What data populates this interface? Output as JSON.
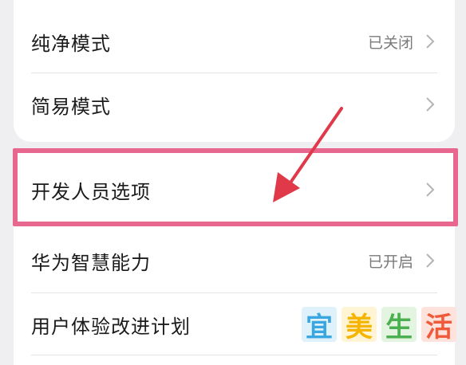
{
  "settings": {
    "pure_mode": {
      "label": "纯净模式",
      "value": "已关闭"
    },
    "simple_mode": {
      "label": "简易模式"
    },
    "developer_options": {
      "label": "开发人员选项"
    },
    "huawei_ai": {
      "label": "华为智慧能力",
      "value": "已开启"
    },
    "ux_plan": {
      "label": "用户体验改进计划"
    }
  },
  "watermark": {
    "chars": [
      "宜",
      "美",
      "生",
      "活"
    ],
    "colors": [
      "#3aa7e0",
      "#f4b400",
      "#4caf50",
      "#ef5b3a"
    ]
  },
  "colors": {
    "highlight": "#e8678f",
    "arrow": "#e03a4a"
  }
}
